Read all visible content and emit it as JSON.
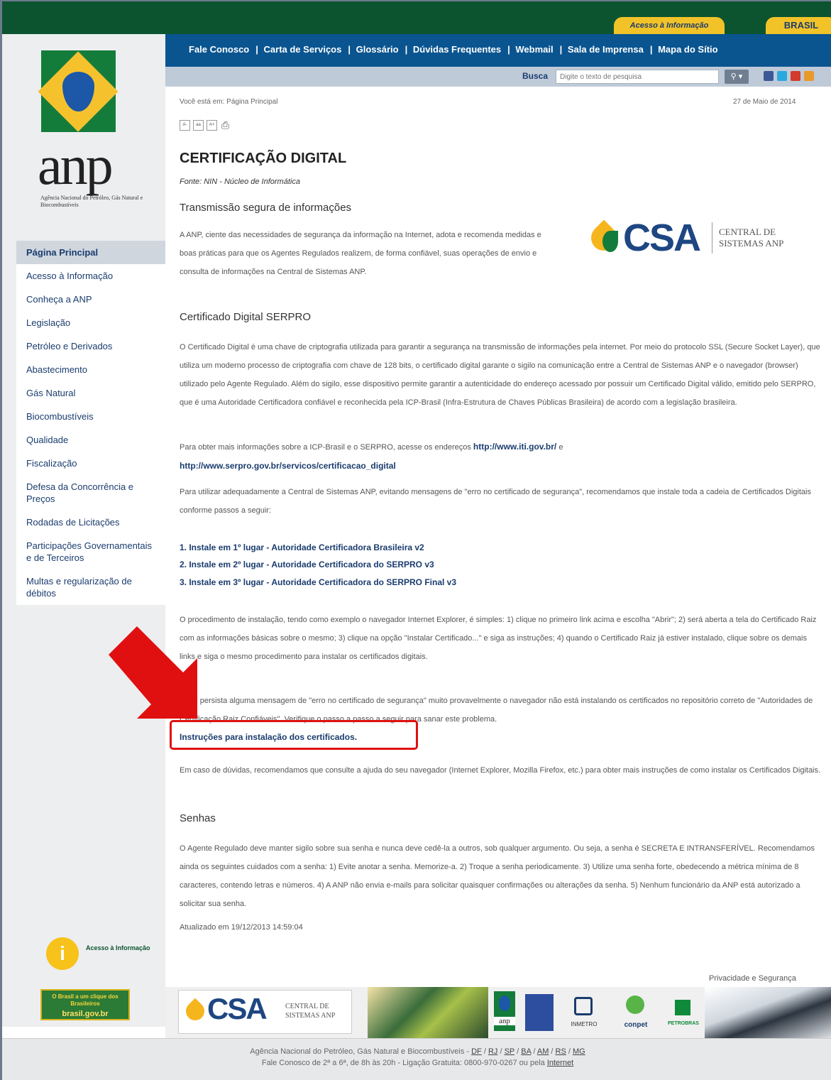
{
  "header": {
    "acesso_tab": "Acesso à Informação",
    "brasil_tab": "BRASIL"
  },
  "nav": {
    "items": [
      "Fale Conosco",
      "Carta de Serviços",
      "Glossário",
      "Dúvidas Frequentes",
      "Webmail",
      "Sala de Imprensa",
      "Mapa do Sítio"
    ]
  },
  "search": {
    "label": "Busca",
    "placeholder": "Digite o texto de pesquisa"
  },
  "logo": {
    "text": "anp",
    "subtitle": "Agência Nacional do Petróleo, Gás Natural e Biocombustíveis"
  },
  "sidebar": {
    "items": [
      "Página Principal",
      "Acesso à Informação",
      "Conheça a ANP",
      "Legislação",
      "Petróleo e Derivados",
      "Abastecimento",
      "Gás Natural",
      "Biocombustíveis",
      "Qualidade",
      "Fiscalização",
      "Defesa da Concorrência e Preços",
      "Rodadas de Licitações",
      "Participações Governamentais e de Terceiros",
      "Multas e regularização de débitos"
    ],
    "acesso_label": "Acesso à Informação",
    "brasil_banner": "O Brasil a um clique dos Brasileiros",
    "brasil_domain": "brasil.gov.br"
  },
  "content": {
    "breadcrumb": "Você está em: Página Principal",
    "date": "27 de Maio de 2014",
    "tools": [
      "A-",
      "aa",
      "A+"
    ],
    "title": "CERTIFICAÇÃO DIGITAL",
    "source": "Fonte: NIN - Núcleo de Informática",
    "section1_title": "Transmissão segura de informações",
    "section1_p": "A ANP, ciente das necessidades de segurança da informação na Internet, adota e recomenda medidas e boas práticas para que os Agentes Regulados realizem, de forma confiável, suas operações de envio e consulta de informações na Central de Sistemas ANP.",
    "csa": {
      "word": "CSA",
      "sub1": "CENTRAL DE",
      "sub2": "SISTEMAS ANP"
    },
    "section2_title": "Certificado Digital SERPRO",
    "section2_p1": "O Certificado Digital é uma chave de criptografia utilizada para garantir a segurança na transmissão de informações pela internet. Por meio do protocolo SSL (Secure Socket Layer), que utiliza um moderno processo de criptografia com chave de 128 bits, o certificado digital garante o sigilo na comunicação entre a Central de Sistemas ANP e o navegador (browser) utilizado pelo Agente Regulado. Além do sigilo, esse dispositivo permite garantir a autenticidade do endereço acessado por possuir um Certificado Digital válido, emitido pelo SERPRO, que é uma Autoridade Certificadora confiável e reconhecida pela ICP-Brasil (Infra-Estrutura de Chaves Públicas Brasileira) de acordo com a legislação brasileira.",
    "section2_p2_text": "Para obter mais informações sobre a ICP-Brasil e o SERPRO, acesse os endereços",
    "link_iti": "http://www.iti.gov.br/",
    "p2_and": "e",
    "link_serpro": "http://www.serpro.gov.br/servicos/certificacao_digital",
    "section2_p3": "Para utilizar adequadamente a Central de Sistemas ANP, evitando mensagens de \"erro no certificado de segurança\", recomendamos que instale toda a cadeia de Certificados Digitais conforme passos a seguir:",
    "steps": [
      "1. Instale em 1º lugar - Autoridade Certificadora Brasileira v2",
      "2. Instale em 2º lugar - Autoridade Certificadora do SERPRO v3",
      "3. Instale em 3º lugar - Autoridade Certificadora do SERPRO Final v3"
    ],
    "section2_p4": "O procedimento de instalação, tendo como exemplo o navegador Internet Explorer, é simples: 1) clique no primeiro link acima e escolha \"Abrir\"; 2) será aberta a tela do Certificado Raiz com as informações básicas sobre o mesmo; 3) clique na opção \"Instalar Certificado...\" e siga as instruções; 4) quando o Certificado Raiz já estiver instalado, clique sobre os demais links e siga o mesmo procedimento para instalar os certificados digitais.",
    "section2_p5": "Caso persista alguma mensagem de \"erro no certificado de segurança\" muito provavelmente o navegador não está instalando os certificados no repositório correto de \"Autoridades de Certificação Raiz Confiáveis\". Verifique o passo a passo a seguir para sanar este problema.",
    "instructions_link": "Instruções para instalação dos certificados.",
    "section2_p6": "Em caso de dúvidas, recomendamos que consulte a ajuda do seu navegador (Internet Explorer, Mozilla Firefox, etc.) para obter mais instruções de como instalar os Certificados Digitais.",
    "section3_title": "Senhas",
    "section3_p": "O Agente Regulado deve manter sigilo sobre sua senha e nunca deve cedê-la a outros, sob qualquer argumento. Ou seja, a senha é SECRETA E INTRANSFERÍVEL. Recomendamos ainda os seguintes cuidados com a senha: 1) Evite anotar a senha. Memorize-a. 2) Troque a senha periodicamente. 3) Utilize uma senha forte, obedecendo a métrica mínima de 8 caracteres, contendo letras e números. 4) A ANP não envia e-mails para solicitar quaisquer confirmações ou alterações da senha. 5) Nenhum funcionário da ANP está autorizado a solicitar sua senha.",
    "updated": "Atualizado em 19/12/2013 14:59:04",
    "privacy": "Privacidade e Segurança"
  },
  "partners": {
    "csa_word": "CSA",
    "csa_sub1": "CENTRAL DE",
    "csa_sub2": "SISTEMAS ANP",
    "anp": "anp",
    "inmetro": "INMETRO",
    "conpet": "conpet",
    "petrobras": "PETROBRAS"
  },
  "footer": {
    "line1_text": "Agência Nacional do Petróleo, Gás Natural e Biocombustíveis -",
    "offices": [
      "DF",
      "RJ",
      "SP",
      "BA",
      "AM",
      "RS",
      "MG"
    ],
    "line2_text": "Fale Conosco de 2ª a 6ª, de 8h às 20h - Ligação Gratuita: 0800-970-0267 ou pela",
    "line2_link": "Internet"
  },
  "colors": {
    "green": "#0c5430",
    "blue_nav": "#0a5590",
    "yellow": "#f2c328",
    "link": "#1a3c6e",
    "highlight": "#e01010"
  }
}
